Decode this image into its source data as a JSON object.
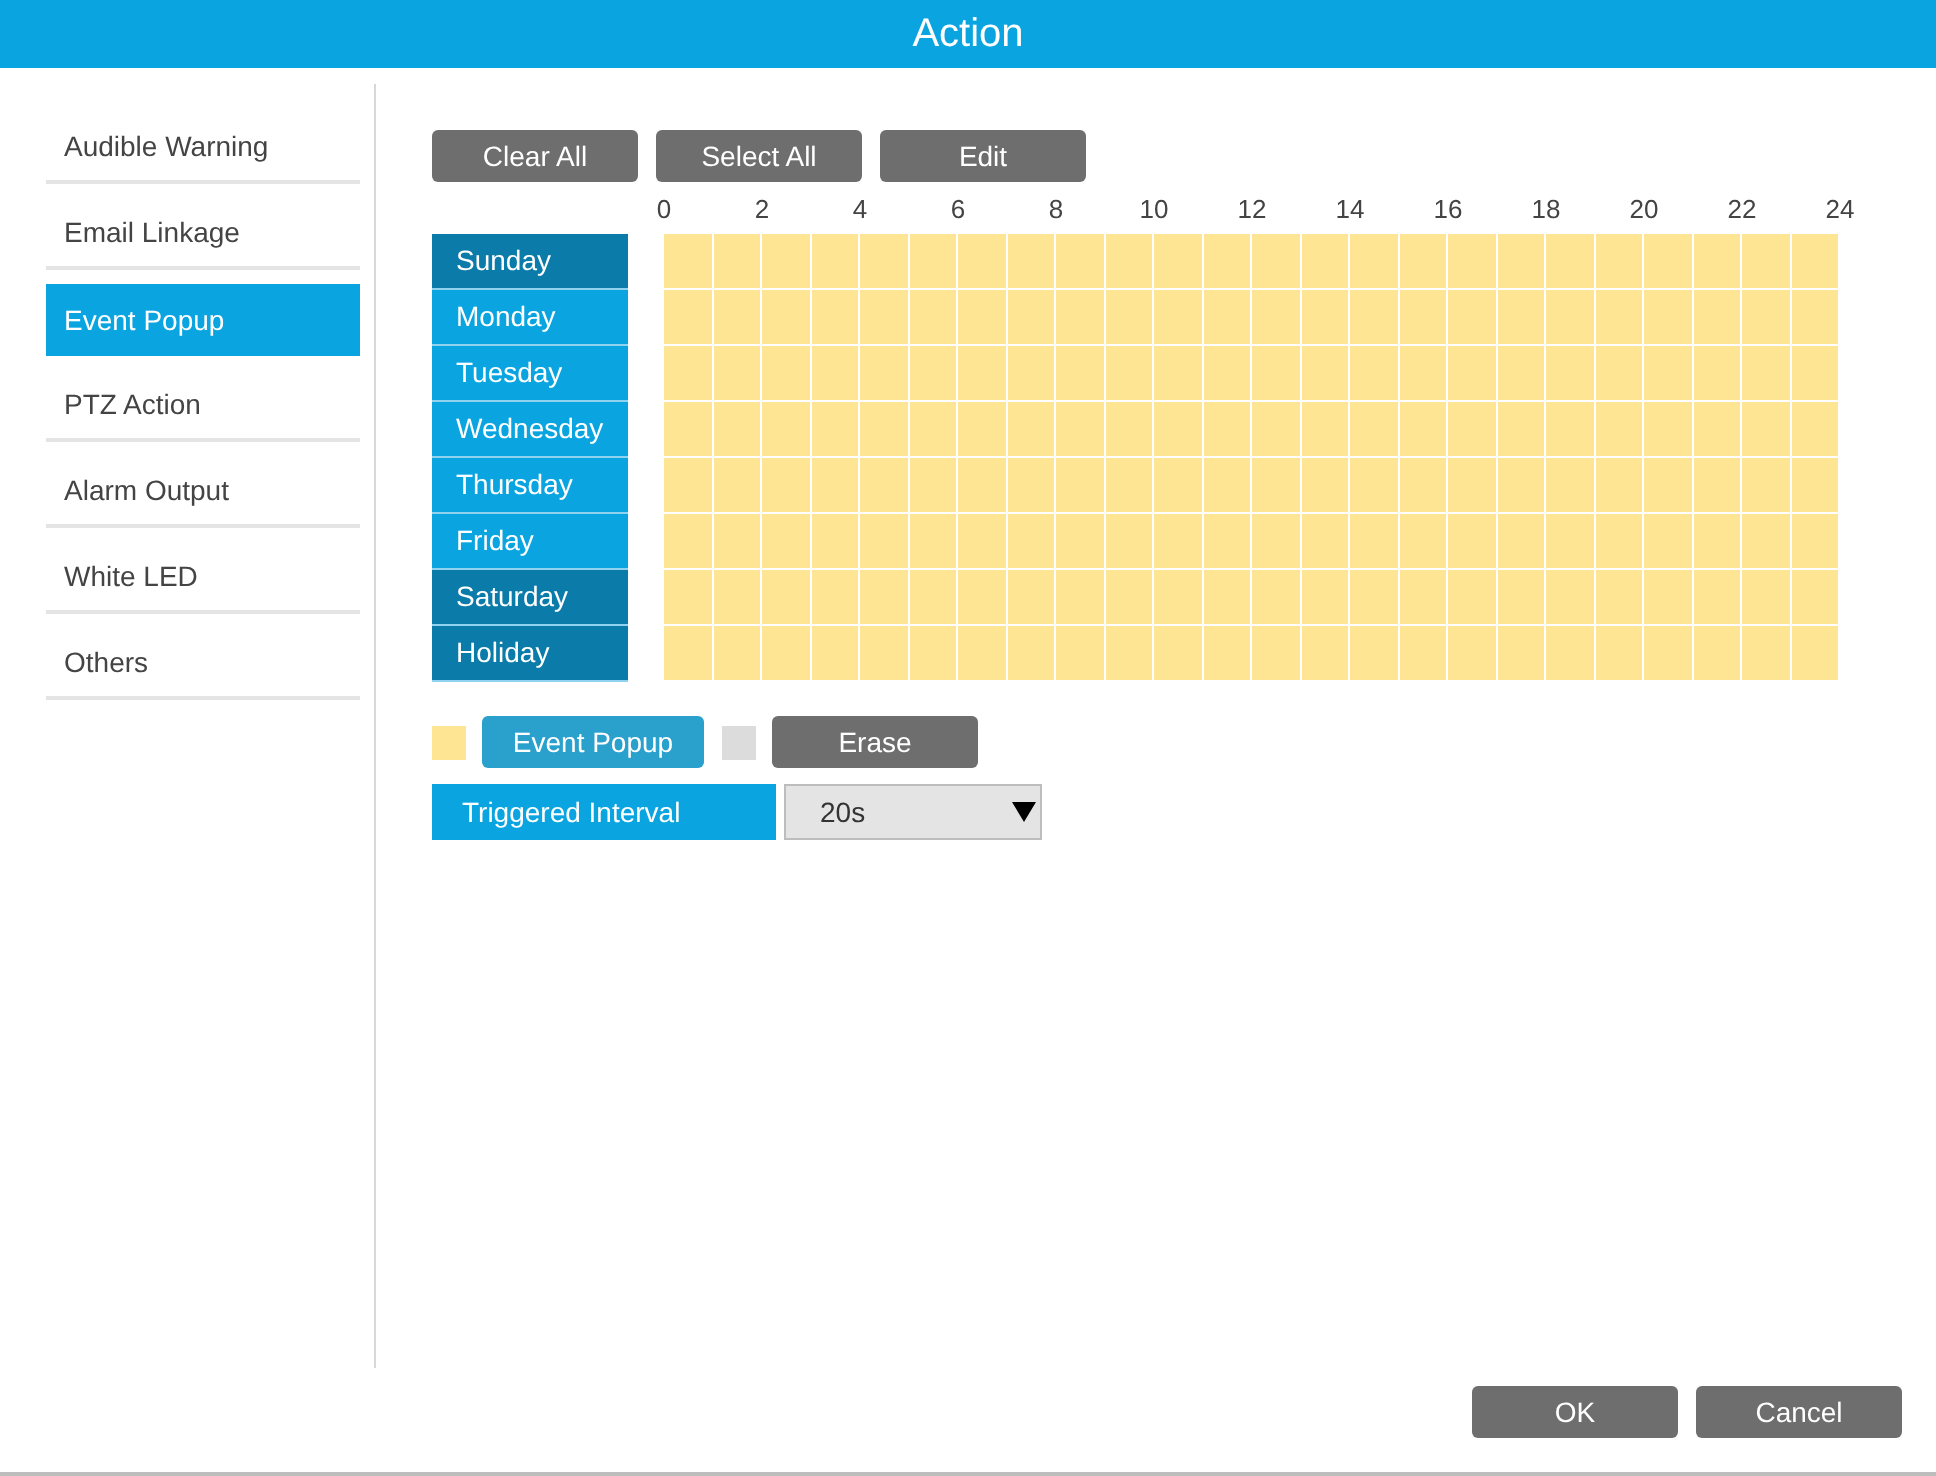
{
  "window": {
    "title": "Action"
  },
  "sidebar": {
    "items": [
      {
        "label": "Audible Warning",
        "selected": false
      },
      {
        "label": "Email Linkage",
        "selected": false
      },
      {
        "label": "Event Popup",
        "selected": true
      },
      {
        "label": "PTZ Action",
        "selected": false
      },
      {
        "label": "Alarm Output",
        "selected": false
      },
      {
        "label": "White LED",
        "selected": false
      },
      {
        "label": "Others",
        "selected": false
      }
    ]
  },
  "toolbar": [
    "Clear All",
    "Select All",
    "Edit"
  ],
  "schedule": {
    "hours": [
      "0",
      "2",
      "4",
      "6",
      "8",
      "10",
      "12",
      "14",
      "16",
      "18",
      "20",
      "22",
      "24"
    ],
    "days": [
      {
        "label": "Sunday",
        "kind": "weekend",
        "slots": [
          true,
          true,
          true,
          true,
          true,
          true,
          true,
          true,
          true,
          true,
          true,
          true,
          true,
          true,
          true,
          true,
          true,
          true,
          true,
          true,
          true,
          true,
          true,
          true
        ]
      },
      {
        "label": "Monday",
        "kind": "weekday",
        "slots": [
          true,
          true,
          true,
          true,
          true,
          true,
          true,
          true,
          true,
          true,
          true,
          true,
          true,
          true,
          true,
          true,
          true,
          true,
          true,
          true,
          true,
          true,
          true,
          true
        ]
      },
      {
        "label": "Tuesday",
        "kind": "weekday",
        "slots": [
          true,
          true,
          true,
          true,
          true,
          true,
          true,
          true,
          true,
          true,
          true,
          true,
          true,
          true,
          true,
          true,
          true,
          true,
          true,
          true,
          true,
          true,
          true,
          true
        ]
      },
      {
        "label": "Wednesday",
        "kind": "weekday",
        "slots": [
          true,
          true,
          true,
          true,
          true,
          true,
          true,
          true,
          true,
          true,
          true,
          true,
          true,
          true,
          true,
          true,
          true,
          true,
          true,
          true,
          true,
          true,
          true,
          true
        ]
      },
      {
        "label": "Thursday",
        "kind": "weekday",
        "slots": [
          true,
          true,
          true,
          true,
          true,
          true,
          true,
          true,
          true,
          true,
          true,
          true,
          true,
          true,
          true,
          true,
          true,
          true,
          true,
          true,
          true,
          true,
          true,
          true
        ]
      },
      {
        "label": "Friday",
        "kind": "weekday",
        "slots": [
          true,
          true,
          true,
          true,
          true,
          true,
          true,
          true,
          true,
          true,
          true,
          true,
          true,
          true,
          true,
          true,
          true,
          true,
          true,
          true,
          true,
          true,
          true,
          true
        ]
      },
      {
        "label": "Saturday",
        "kind": "weekend",
        "slots": [
          true,
          true,
          true,
          true,
          true,
          true,
          true,
          true,
          true,
          true,
          true,
          true,
          true,
          true,
          true,
          true,
          true,
          true,
          true,
          true,
          true,
          true,
          true,
          true
        ]
      },
      {
        "label": "Holiday",
        "kind": "weekend",
        "slots": [
          true,
          true,
          true,
          true,
          true,
          true,
          true,
          true,
          true,
          true,
          true,
          true,
          true,
          true,
          true,
          true,
          true,
          true,
          true,
          true,
          true,
          true,
          true,
          true
        ]
      }
    ]
  },
  "legend": [
    {
      "label": "Event Popup",
      "color": "#fee594",
      "selected": true
    },
    {
      "label": "Erase",
      "color": "#dcdcdc",
      "selected": false
    }
  ],
  "triggered_interval": {
    "label": "Triggered Interval",
    "value": "20s"
  },
  "buttons": [
    "OK",
    "Cancel"
  ]
}
